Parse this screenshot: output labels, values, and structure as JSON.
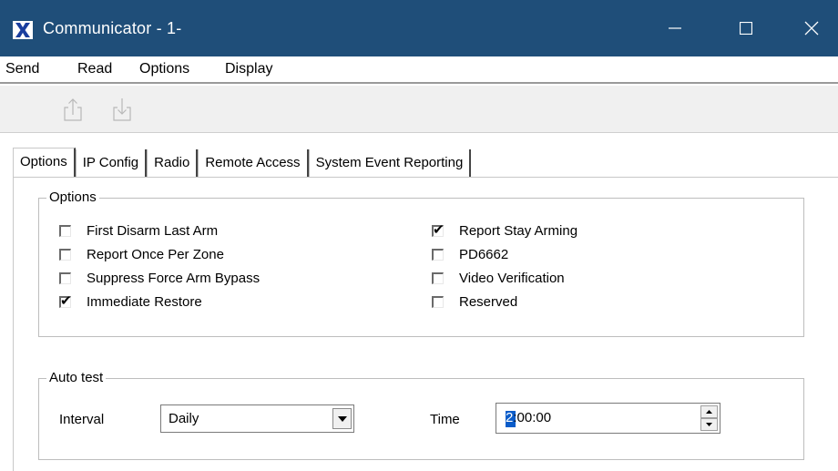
{
  "window": {
    "title": "Communicator - 1-",
    "title_color": "#1f4e79"
  },
  "menu": [
    {
      "label": "Send"
    },
    {
      "label": "Read"
    },
    {
      "label": "Options"
    },
    {
      "label": "Display"
    }
  ],
  "toolbar": {
    "buttons": [
      {
        "icon": "upload-icon"
      },
      {
        "icon": "download-icon"
      }
    ]
  },
  "tabs": [
    {
      "label": "Options",
      "active": true
    },
    {
      "label": "IP Config"
    },
    {
      "label": "Radio"
    },
    {
      "label": "Remote Access"
    },
    {
      "label": "System Event Reporting"
    }
  ],
  "options_group": {
    "title": "Options",
    "left": [
      {
        "label": "First Disarm Last Arm",
        "checked": false
      },
      {
        "label": "Report Once Per Zone",
        "checked": false
      },
      {
        "label": "Suppress Force Arm Bypass",
        "checked": false
      },
      {
        "label": "Immediate Restore",
        "checked": true
      }
    ],
    "right": [
      {
        "label": "Report Stay Arming",
        "checked": true
      },
      {
        "label": "PD6662",
        "checked": false
      },
      {
        "label": "Video Verification",
        "checked": false
      },
      {
        "label": "Reserved",
        "checked": false
      }
    ]
  },
  "auto_test": {
    "title": "Auto test",
    "interval_label": "Interval",
    "interval_value": "Daily",
    "time_label": "Time",
    "time_first": "2",
    "time_rest": ":00:00"
  },
  "check_mark": "✔"
}
